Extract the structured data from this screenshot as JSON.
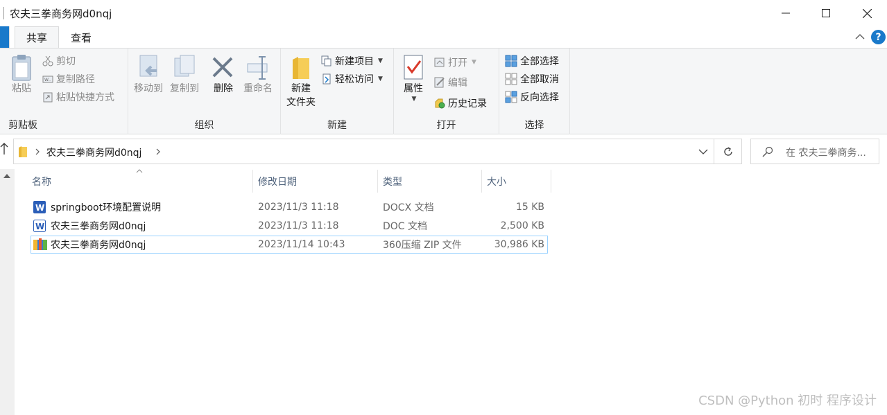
{
  "window": {
    "title": "农夫三拳商务网d0nqj"
  },
  "tabs": [
    {
      "label": "共享"
    },
    {
      "label": "查看"
    }
  ],
  "ribbon": {
    "groups": [
      {
        "label": "剪贴板"
      },
      {
        "label": "组织"
      },
      {
        "label": "新建"
      },
      {
        "label": "打开"
      },
      {
        "label": "选择"
      }
    ],
    "clipboard": {
      "paste": "粘贴",
      "cut": "剪切",
      "copy_path": "复制路径",
      "paste_shortcut": "粘贴快捷方式"
    },
    "organize": {
      "move_to": "移动到",
      "copy_to": "复制到",
      "delete": "删除",
      "rename": "重命名"
    },
    "new": {
      "new_folder_line1": "新建",
      "new_folder_line2": "文件夹",
      "new_item": "新建项目",
      "easy_access": "轻松访问"
    },
    "open": {
      "properties": "属性",
      "open": "打开",
      "edit": "编辑",
      "history": "历史记录"
    },
    "select": {
      "select_all": "全部选择",
      "select_none": "全部取消",
      "invert": "反向选择"
    }
  },
  "address": {
    "path": "农夫三拳商务网d0nqj",
    "search_placeholder": "在 农夫三拳商务..."
  },
  "columns": {
    "name": "名称",
    "date": "修改日期",
    "type": "类型",
    "size": "大小"
  },
  "files": [
    {
      "name": "springboot环境配置说明",
      "date": "2023/11/3 11:18",
      "type": "DOCX 文档",
      "size": "15 KB",
      "icon": "word-icon"
    },
    {
      "name": "农夫三拳商务网d0nqj",
      "date": "2023/11/3 11:18",
      "type": "DOC 文档",
      "size": "2,500 KB",
      "icon": "word-icon"
    },
    {
      "name": "农夫三拳商务网d0nqj",
      "date": "2023/11/14 10:43",
      "type": "360压缩 ZIP 文件",
      "size": "30,986 KB",
      "icon": "zip-archive-icon"
    }
  ],
  "watermark": "CSDN @Python 初时 程序设计",
  "colors": {
    "accent": "#1979ca",
    "selection_border": "#99d1ff",
    "ribbon_bg": "#f5f6f7",
    "column_header_text": "#4c607a"
  }
}
